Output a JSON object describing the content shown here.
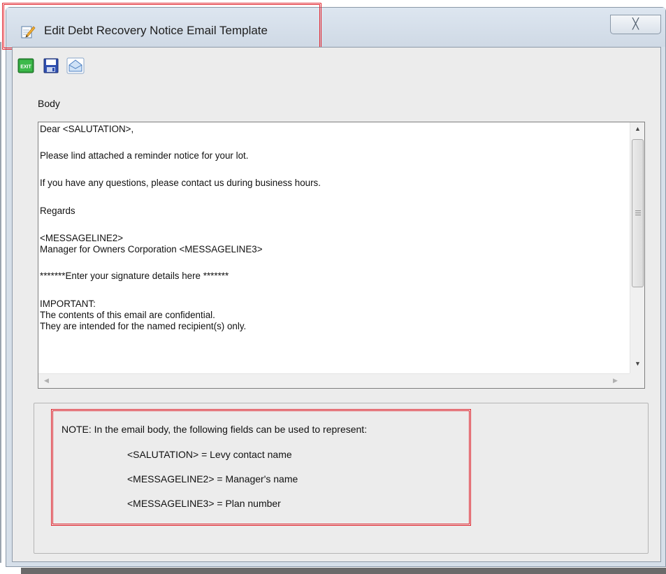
{
  "window": {
    "title": "Edit Debt Recovery Notice Email Template",
    "close_glyph": "╳"
  },
  "toolbar": {
    "buttons": [
      {
        "name": "exit-icon",
        "label": "EXIT"
      },
      {
        "name": "save-icon",
        "label": ""
      },
      {
        "name": "email-icon",
        "label": ""
      }
    ]
  },
  "body_label": "Body",
  "editor": {
    "lines": [
      "Dear <SALUTATION>,",
      "",
      "Please lind attached a reminder notice for your lot.",
      "",
      "If you have any questions, please contact us during business hours.",
      "",
      "Regards",
      "",
      "<MESSAGELINE2>",
      "Manager for Owners Corporation <MESSAGELINE3>",
      "",
      "*******Enter your signature details here *******",
      "",
      "IMPORTANT:",
      "The contents of this email are confidential.",
      "They are intended for the named recipient(s) only."
    ]
  },
  "note": {
    "heading": "NOTE: In the email body, the following fields can be used to represent:",
    "fields": [
      "<SALUTATION> = Levy contact name",
      "<MESSAGELINE2> = Manager's name",
      "<MESSAGELINE3> = Plan number"
    ]
  },
  "colors": {
    "highlight": "#e0202a",
    "window_frame": "#d6dfe9",
    "client_bg": "#ececec"
  }
}
